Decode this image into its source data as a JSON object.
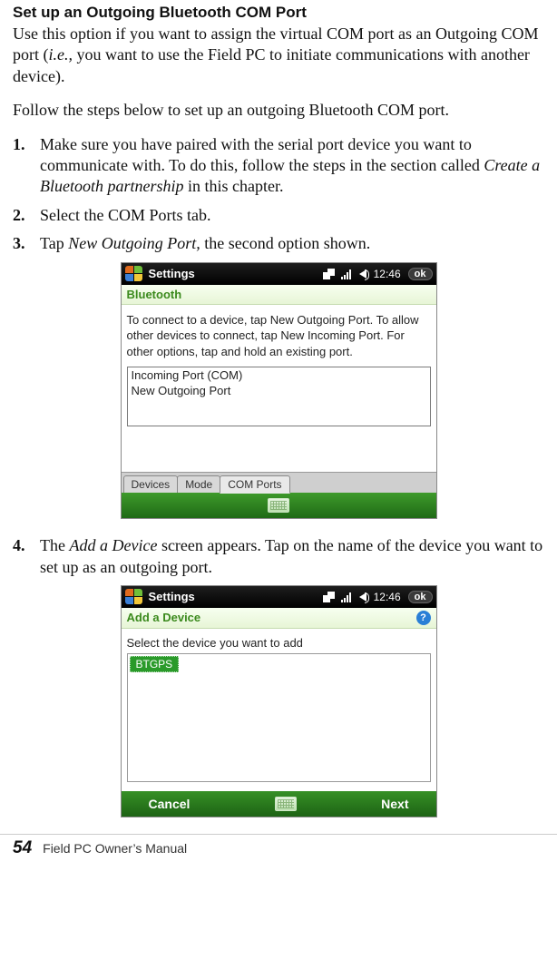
{
  "heading": "Set up an Outgoing Bluetooth COM Port",
  "intro_a": "Use this option if you want to assign the virtual COM port as an Outgoing COM port (",
  "intro_ie": "i.e.,",
  "intro_b": " you want to use the Field PC to initiate communications with another device).",
  "follow": "Follow the steps below to set up an outgoing Bluetooth COM port.",
  "step1_a": "Make sure you have paired with the serial port device you want to communicate with. To do this, follow the steps in the section called ",
  "step1_i": "Create a Bluetooth partnership",
  "step1_b": " in this chapter.",
  "step2": "Select the COM Ports tab.",
  "step3_a": "Tap ",
  "step3_i": "New Outgoing Port,",
  "step3_b": " the second option shown.",
  "step4_a": "The ",
  "step4_i": "Add a Device",
  "step4_b": " screen appears. Tap on the name of the device you want to set up as an outgoing port.",
  "wmA": {
    "title": "Settings",
    "time": "12:46",
    "ok": "ok",
    "panel": "Bluetooth",
    "body": "To connect to a device, tap New Outgoing Port. To allow other devices to connect, tap New Incoming Port. For other options, tap and hold an existing port.",
    "list0": "Incoming Port  (COM)",
    "list1": "New Outgoing Port",
    "tab0": "Devices",
    "tab1": "Mode",
    "tab2": "COM Ports"
  },
  "wmB": {
    "title": "Settings",
    "time": "12:46",
    "ok": "ok",
    "panel": "Add a Device",
    "body": "Select the device you want to add",
    "device": "BTGPS",
    "cancel": "Cancel",
    "next": "Next"
  },
  "footer": {
    "page": "54",
    "book": "Field PC Owner’s Manual"
  }
}
